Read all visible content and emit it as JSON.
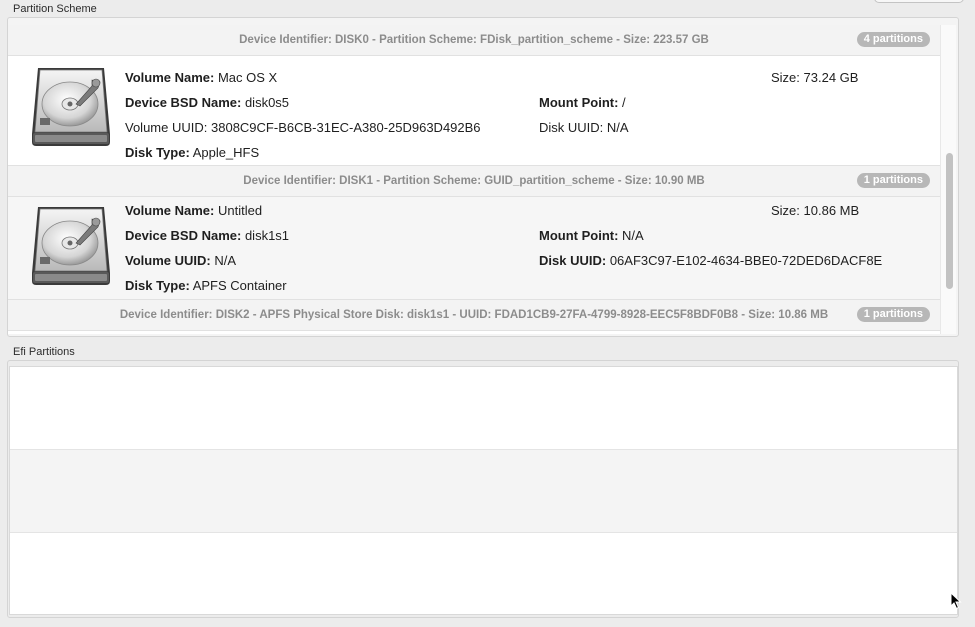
{
  "groups": {
    "partition_scheme": "Partition Scheme",
    "efi_partitions": "Efi Partitions"
  },
  "labels": {
    "volume_name": "Volume Name:",
    "device_bsd_name": "Device BSD Name:",
    "volume_uuid": "Volume UUID:",
    "disk_type": "Disk Type:",
    "size": "Size:",
    "mount_point": "Mount Point:",
    "disk_uuid": "Disk UUID:"
  },
  "disk0": {
    "header": "Device Identifier: DISK0 - Partition Scheme: FDisk_partition_scheme - Size: 223.57 GB",
    "badge": "4 partitions",
    "volume": {
      "name": "Mac OS X",
      "bsd": "disk0s5",
      "uuid": "3808C9CF-B6CB-31EC-A380-25D963D492B6",
      "type": "Apple_HFS",
      "size": "73.24 GB",
      "mount": "/",
      "disk_uuid": "N/A"
    }
  },
  "disk1": {
    "header": "Device Identifier: DISK1 - Partition Scheme: GUID_partition_scheme - Size: 10.90 MB",
    "badge": "1 partitions",
    "volume": {
      "name": "Untitled",
      "bsd": "disk1s1",
      "uuid": "N/A",
      "type": "APFS Container",
      "size": "10.86 MB",
      "mount": "N/A",
      "disk_uuid": "06AF3C97-E102-4634-BBE0-72DED6DACF8E"
    }
  },
  "disk2": {
    "header": "Device Identifier: DISK2 - APFS Physical Store Disk: disk1s1 - UUID: FDAD1CB9-27FA-4799-8928-EEC5F8BDF0B8 - Size: 10.86 MB",
    "badge": "1 partitions"
  },
  "colors": {
    "header_text": "#8c8c8c",
    "badge_bg": "#b7b7b7",
    "row_alt": "#f4f4f4"
  },
  "icons": {
    "drive": "hard-drive-icon",
    "cursor": "mouse-cursor-icon"
  }
}
